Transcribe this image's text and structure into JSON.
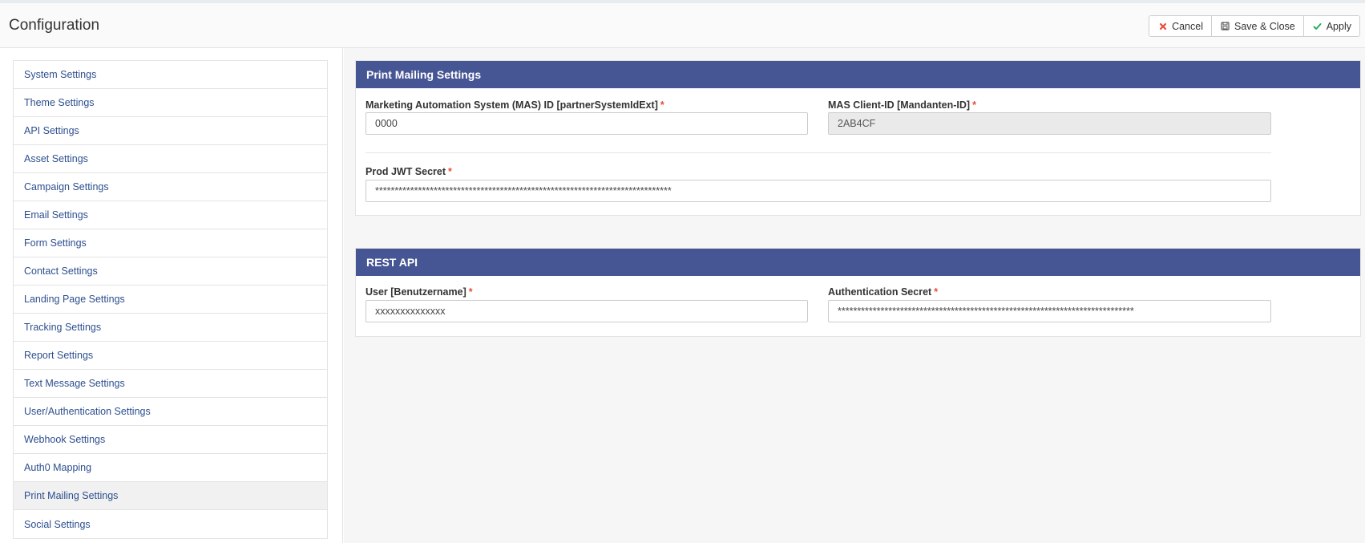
{
  "header": {
    "title": "Configuration",
    "buttons": {
      "cancel": "Cancel",
      "save_close": "Save & Close",
      "apply": "Apply"
    }
  },
  "icons": {
    "cancel": "close-icon",
    "save_close": "save-icon",
    "apply": "check-icon"
  },
  "colors": {
    "panel_header": "#465593",
    "link": "#2d4f8f",
    "required": "#e74c3c",
    "cancel_icon": "#e74c3c",
    "apply_icon": "#27ae60"
  },
  "sidebar": {
    "items": [
      {
        "label": "System Settings"
      },
      {
        "label": "Theme Settings"
      },
      {
        "label": "API Settings"
      },
      {
        "label": "Asset Settings"
      },
      {
        "label": "Campaign Settings"
      },
      {
        "label": "Email Settings"
      },
      {
        "label": "Form Settings"
      },
      {
        "label": "Contact Settings"
      },
      {
        "label": "Landing Page Settings"
      },
      {
        "label": "Tracking Settings"
      },
      {
        "label": "Report Settings"
      },
      {
        "label": "Text Message Settings"
      },
      {
        "label": "User/Authentication Settings"
      },
      {
        "label": "Webhook Settings"
      },
      {
        "label": "Auth0 Mapping"
      },
      {
        "label": "Print Mailing Settings"
      },
      {
        "label": "Social Settings"
      }
    ],
    "active_index": 15
  },
  "print_mailing": {
    "title": "Print Mailing Settings",
    "mas_id": {
      "label": "Marketing Automation System (MAS) ID [partnerSystemIdExt]",
      "value": "0000",
      "required_mark": "*"
    },
    "client_id": {
      "label": "MAS Client-ID [Mandanten-ID]",
      "value": "2AB4CF",
      "required_mark": "*"
    },
    "jwt_secret": {
      "label": "Prod JWT Secret",
      "value": "****************************************************************************",
      "required_mark": "*"
    }
  },
  "rest_api": {
    "title": "REST API",
    "user": {
      "label": "User [Benutzername]",
      "value": "xxxxxxxxxxxxxx",
      "required_mark": "*"
    },
    "auth_secret": {
      "label": "Authentication Secret",
      "value": "****************************************************************************",
      "required_mark": "*"
    }
  }
}
